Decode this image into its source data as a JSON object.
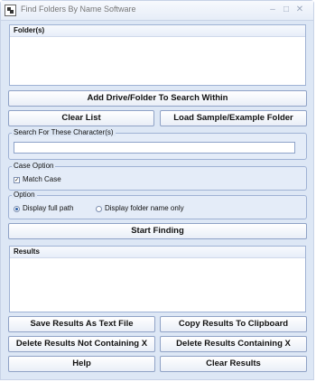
{
  "window": {
    "title": "Find Folders By Name Software"
  },
  "folders_panel": {
    "header": "Folder(s)"
  },
  "buttons": {
    "add_drive": "Add Drive/Folder To Search Within",
    "clear_list": "Clear List",
    "load_sample": "Load Sample/Example Folder",
    "start_finding": "Start Finding",
    "save_text": "Save Results As Text File",
    "copy_clipboard": "Copy Results To Clipboard",
    "delete_not_containing": "Delete Results Not Containing X",
    "delete_containing": "Delete Results Containing X",
    "help": "Help",
    "clear_results": "Clear Results"
  },
  "search": {
    "group_title": "Search For These Character(s)",
    "value": ""
  },
  "case_option": {
    "group_title": "Case Option",
    "match_case_label": "Match Case",
    "match_case_checked": true
  },
  "option": {
    "group_title": "Option",
    "full_path_label": "Display full path",
    "folder_name_label": "Display folder name only",
    "selected": "full_path"
  },
  "results_panel": {
    "header": "Results"
  }
}
